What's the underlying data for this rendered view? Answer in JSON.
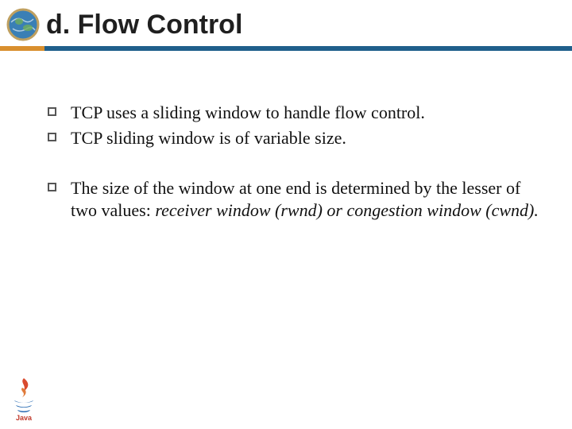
{
  "title": "d. Flow Control",
  "bullets_group1": [
    "TCP uses a sliding window to handle flow control.",
    "TCP sliding window is of variable size."
  ],
  "bullet3_part1": "The size of the window at one end is determined by the lesser of two values: ",
  "bullet3_italic": "receiver window (rwnd) or congestion window (cwnd).",
  "icons": {
    "globe": "globe-icon",
    "java": "java-logo-icon"
  }
}
